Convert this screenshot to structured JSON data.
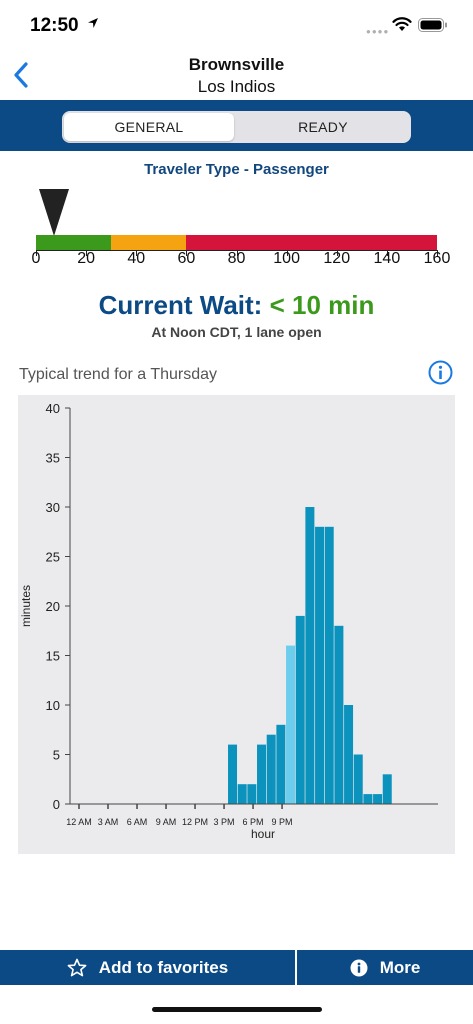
{
  "status_bar": {
    "time": "12:50"
  },
  "header": {
    "title": "Brownsville",
    "subtitle": "Los Indios"
  },
  "segments": {
    "general": "GENERAL",
    "ready": "READY",
    "selected": "general"
  },
  "traveler_type": "Traveler Type - Passenger",
  "wait_scale": {
    "labels": [
      "0",
      "20",
      "40",
      "60",
      "80",
      "100",
      "120",
      "140",
      "160"
    ],
    "max": 160,
    "current_level": 7,
    "bands": [
      {
        "from": 0,
        "to": 30,
        "color": "#3b9a1b"
      },
      {
        "from": 30,
        "to": 60,
        "color": "#f5a311"
      },
      {
        "from": 60,
        "to": 160,
        "color": "#d4143a"
      }
    ]
  },
  "current_wait": {
    "label": "Current Wait:",
    "value": "< 10 min",
    "detail": "At Noon CDT, 1 lane open"
  },
  "trend": {
    "title": "Typical trend for a Thursday"
  },
  "footer": {
    "favorites_label": "Add to favorites",
    "more_label": "More"
  },
  "colors": {
    "navy": "#0b4a85",
    "bar": "#0b93bd",
    "current_bar": "#6dcdec",
    "green": "#3b9a1b"
  },
  "chart_data": {
    "type": "bar",
    "ylabel": "minutes",
    "xlabel": "hour",
    "ylim": [
      0,
      40
    ],
    "yticks": [
      0,
      5,
      10,
      15,
      20,
      25,
      30,
      35,
      40
    ],
    "xtick_labels": [
      "12 AM",
      "3 AM",
      "6 AM",
      "9 AM",
      "12 PM",
      "3 PM",
      "6 PM",
      "9 PM"
    ],
    "xtick_hours": [
      0,
      3,
      6,
      9,
      12,
      15,
      18,
      21
    ],
    "current_hour": 12,
    "hours": [
      0,
      1,
      2,
      3,
      4,
      5,
      6,
      7,
      8,
      9,
      10,
      11,
      12,
      13,
      14,
      15,
      16,
      17,
      18,
      19,
      20,
      21,
      22,
      23
    ],
    "values": [
      0,
      0,
      0,
      0,
      0,
      0,
      6,
      2,
      2,
      6,
      7,
      8,
      16,
      19,
      30,
      28,
      28,
      18,
      10,
      5,
      1,
      1,
      3,
      0
    ],
    "grid": false
  }
}
